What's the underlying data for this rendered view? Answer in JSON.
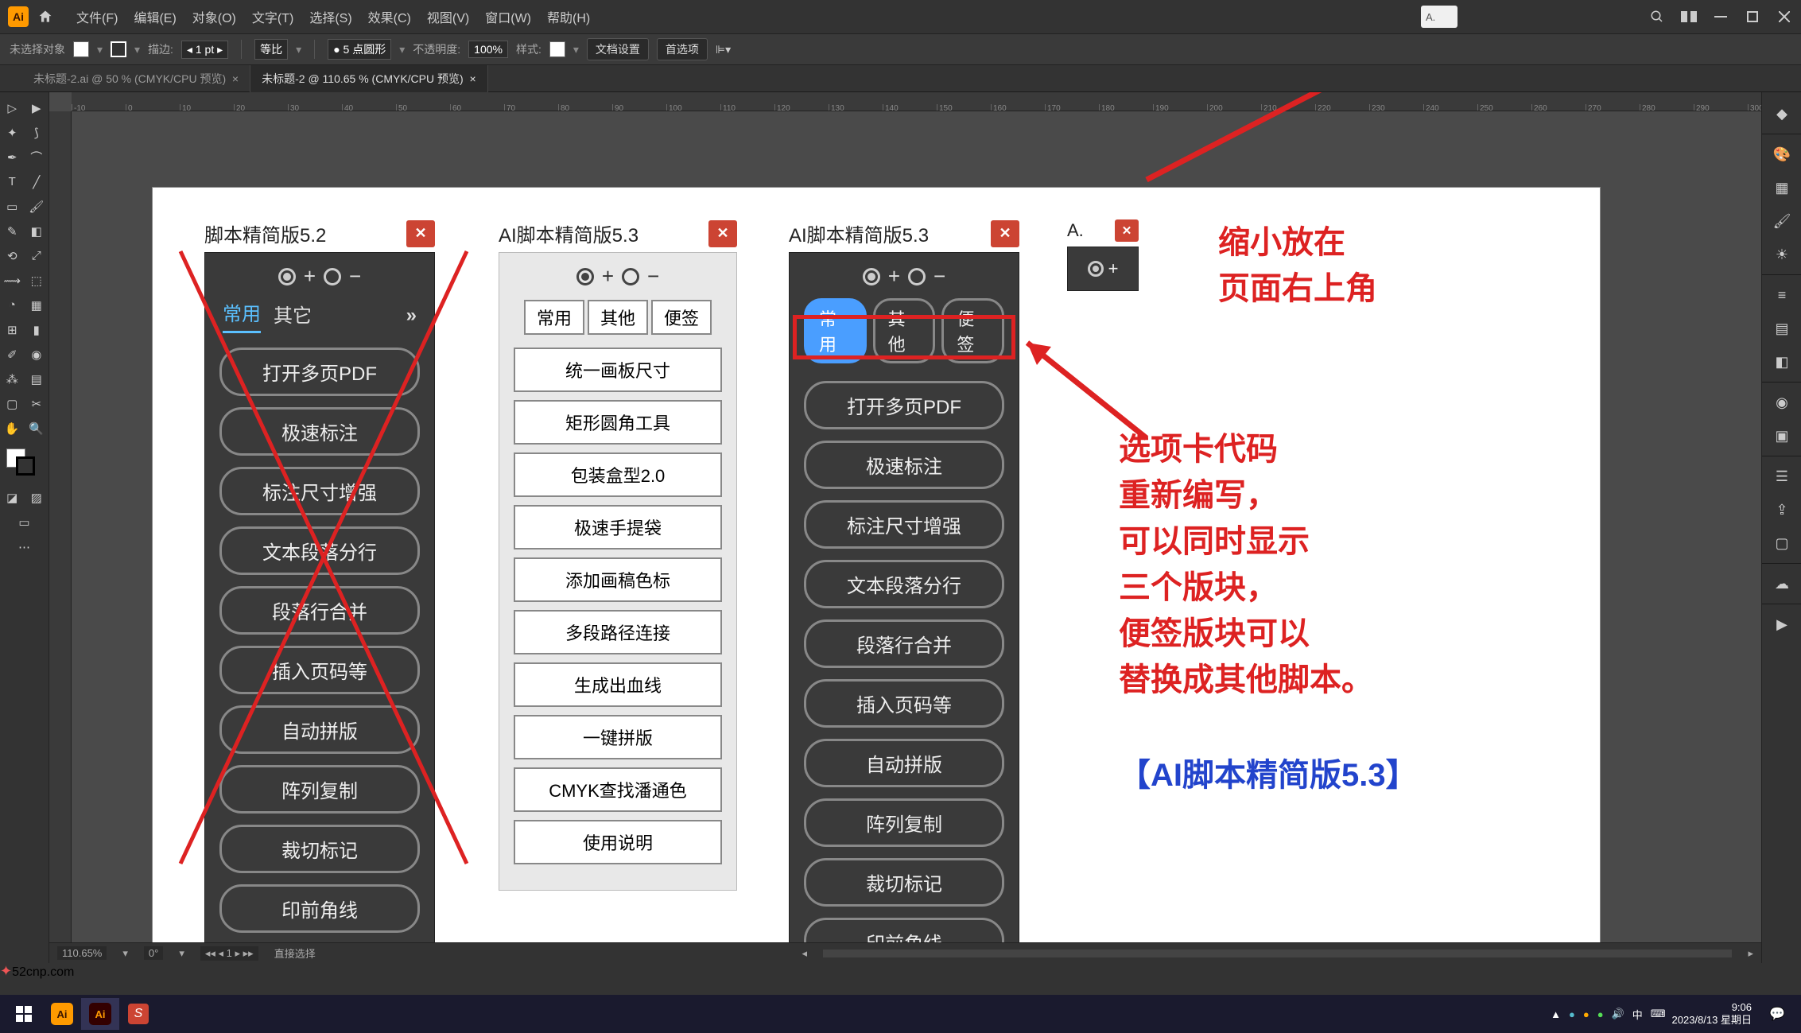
{
  "menubar": {
    "items": [
      "文件(F)",
      "编辑(E)",
      "对象(O)",
      "文字(T)",
      "选择(S)",
      "效果(C)",
      "视图(V)",
      "窗口(W)",
      "帮助(H)"
    ],
    "search_placeholder": "A."
  },
  "controlbar": {
    "no_selection": "未选择对象",
    "stroke_label": "描边:",
    "stroke_value": "1 pt",
    "uniform": "等比",
    "corner_label": "5 点圆形",
    "opacity_label": "不透明度:",
    "opacity_value": "100%",
    "style_label": "样式:",
    "doc_setup": "文档设置",
    "preferences": "首选项"
  },
  "tabs": {
    "tab1": "未标题-2.ai @ 50 % (CMYK/CPU 预览)",
    "tab2": "未标题-2 @ 110.65 % (CMYK/CPU 预览)"
  },
  "ruler_ticks": [
    -10,
    0,
    10,
    20,
    30,
    40,
    50,
    60,
    70,
    80,
    90,
    100,
    110,
    120,
    130,
    140,
    150,
    160,
    170,
    180,
    190,
    200,
    210,
    220,
    230,
    240,
    250,
    260,
    270,
    280,
    290,
    300
  ],
  "panel52": {
    "title": "脚本精简版5.2",
    "tabs": {
      "a": "常用",
      "b": "其它"
    },
    "buttons": [
      "打开多页PDF",
      "极速标注",
      "标注尺寸增强",
      "文本段落分行",
      "段落行合并",
      "插入页码等",
      "自动拼版",
      "阵列复制",
      "裁切标记",
      "印前角线"
    ]
  },
  "panel53light": {
    "title": "AI脚本精简版5.3",
    "tabs": {
      "a": "常用",
      "b": "其他",
      "c": "便签"
    },
    "buttons": [
      "统一画板尺寸",
      "矩形圆角工具",
      "包装盒型2.0",
      "极速手提袋",
      "添加画稿色标",
      "多段路径连接",
      "生成出血线",
      "一键拼版",
      "CMYK查找潘通色",
      "使用说明"
    ]
  },
  "panel53dark": {
    "title": "AI脚本精简版5.3",
    "tabs": {
      "a": "常用",
      "b": "其他",
      "c": "便签"
    },
    "buttons": [
      "打开多页PDF",
      "极速标注",
      "标注尺寸增强",
      "文本段落分行",
      "段落行合并",
      "插入页码等",
      "自动拼版",
      "阵列复制",
      "裁切标记",
      "印前角线"
    ]
  },
  "panelmini": {
    "title": "A."
  },
  "annotations": {
    "top1": "缩小放在",
    "top2": "页面右上角",
    "mid1": "选项卡代码",
    "mid2": "重新编写，",
    "mid3": "可以同时显示",
    "mid4": "三个版块，",
    "mid5": "便签版块可以",
    "mid6": "替换成其他脚本。",
    "bottom": "【AI脚本精简版5.3】"
  },
  "statusbar": {
    "zoom": "110.65%",
    "rotate": "0°",
    "artboard": "1",
    "tool": "直接选择"
  },
  "taskbar": {
    "time": "9:06",
    "date": "2023/8/13 星期日"
  },
  "watermark": "52cnp.com"
}
